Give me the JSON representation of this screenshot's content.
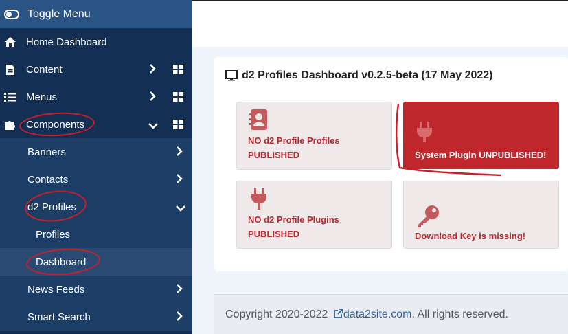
{
  "sidebar": {
    "toggle_label": "Toggle Menu",
    "items": [
      {
        "label": "Home Dashboard"
      },
      {
        "label": "Content"
      },
      {
        "label": "Menus"
      },
      {
        "label": "Components"
      }
    ],
    "sub_items": [
      {
        "label": "Banners"
      },
      {
        "label": "Contacts"
      },
      {
        "label": "d2 Profiles"
      },
      {
        "label": "Profiles"
      },
      {
        "label": "Dashboard"
      },
      {
        "label": "News Feeds"
      },
      {
        "label": "Smart Search"
      }
    ]
  },
  "card": {
    "title": "d2 Profiles Dashboard v0.2.5-beta (17 May 2022)",
    "tiles": [
      {
        "line1": "NO d2 Profile Profiles",
        "line2": "PUBLISHED",
        "icon": "address-book-icon"
      },
      {
        "line1": "System Plugin UNPUBLISHED!",
        "icon": "plug-icon"
      },
      {
        "line1": "NO d2 Profile Plugins",
        "line2": "PUBLISHED",
        "icon": "plug-icon"
      },
      {
        "line1": "Download Key is missing!",
        "icon": "key-icon"
      }
    ]
  },
  "footer": {
    "prefix": "Copyright 2020-2022",
    "link": "data2site.com",
    "suffix": ". All rights reserved."
  },
  "colors": {
    "sidebar": "#132f53",
    "accent": "#c0272d",
    "toggle": "#2a5486"
  }
}
